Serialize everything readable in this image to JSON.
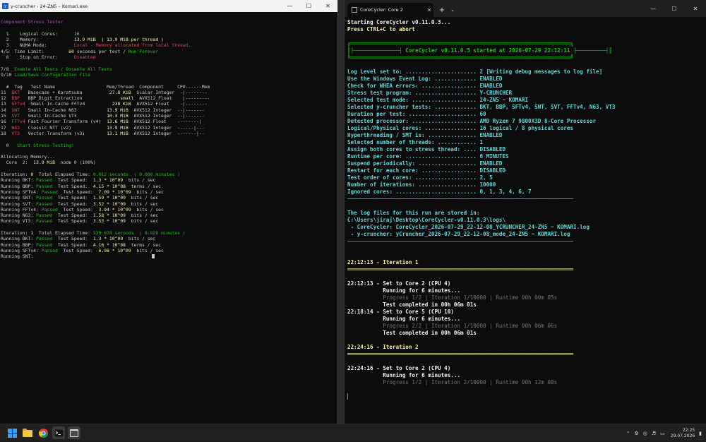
{
  "left_window": {
    "title": "y-cruncher - 24-ZN5 – Komari.exe",
    "lines": [
      [
        [
          "",
          ""
        ]
      ],
      [
        [
          "c-magenta",
          "Component Stress Tester"
        ]
      ],
      [
        [
          "",
          ""
        ]
      ],
      [
        [
          "",
          "  1    Logical Cores:      "
        ],
        [
          "c-cyan",
          "16"
        ]
      ],
      [
        [
          "",
          "  2    Memory:             "
        ],
        [
          "c-yellow",
          "13.9 MiB  ( 13.9 MiB per thread )"
        ]
      ],
      [
        [
          "",
          "  3    NUMA Mode:          "
        ],
        [
          "c-red",
          "Local - Memory allocated from local thread."
        ]
      ],
      [
        [
          "",
          "4/5  Time Limit:         "
        ],
        [
          "c-yellow",
          "60"
        ],
        [
          "",
          " seconds per test / "
        ],
        [
          "c-green",
          "Run Forever"
        ]
      ],
      [
        [
          "",
          "  6    Stop on Error:      "
        ],
        [
          "c-red",
          "Disabled"
        ]
      ],
      [
        [
          "",
          ""
        ]
      ],
      [
        [
          "",
          "7/8  "
        ],
        [
          "c-green",
          "Enable All Tests / Disable All Tests"
        ]
      ],
      [
        [
          "",
          "9/10 "
        ],
        [
          "c-green",
          "Load/Save Configuration File"
        ]
      ],
      [
        [
          "",
          ""
        ]
      ],
      [
        [
          "",
          "  #  Tag   Test Name                   Mem/Thread  Component     CPU------Mem"
        ]
      ],
      [
        [
          "",
          "11  "
        ],
        [
          "c-red",
          "BKT"
        ],
        [
          "",
          "   Basecase + Karatsuba          "
        ],
        [
          "c-yellow",
          "27.8 KiB"
        ],
        [
          "",
          "  Scalar Integer  -|--------"
        ]
      ],
      [
        [
          "",
          "12  "
        ],
        [
          "c-red",
          "BBP"
        ],
        [
          "",
          "   BBP Digit Extraction              "
        ],
        [
          "c-yellow",
          "small"
        ],
        [
          "",
          "  AVX512 Float    |---------"
        ]
      ],
      [
        [
          "",
          "13  "
        ],
        [
          "c-red",
          "SFTv4"
        ],
        [
          "",
          "  Small In-Cache FFTv4          "
        ],
        [
          "c-yellow",
          "238 KiB"
        ],
        [
          "",
          "  AVX512 Float    -|--------"
        ]
      ],
      [
        [
          "",
          "14  "
        ],
        [
          "c-red",
          "SNT"
        ],
        [
          "",
          "   Small In-Cache N63           "
        ],
        [
          "c-yellow",
          "13.9 MiB"
        ],
        [
          "",
          "  AVX512 Integer  --|-------"
        ]
      ],
      [
        [
          "",
          "15  "
        ],
        [
          "c-red",
          "SVT"
        ],
        [
          "",
          "   Small In-Cache VT3           "
        ],
        [
          "c-yellow",
          "10.3 MiB"
        ],
        [
          "",
          "  AVX512 Integer  --|-------"
        ]
      ],
      [
        [
          "",
          "16  "
        ],
        [
          "c-red",
          "FFTv4"
        ],
        [
          "",
          " Fast Fourier Transform (v4)  "
        ],
        [
          "c-yellow",
          "13.6 MiB"
        ],
        [
          "",
          "  AVX512 Float    --------|"
        ]
      ],
      [
        [
          "",
          "17  "
        ],
        [
          "c-red",
          "N63"
        ],
        [
          "",
          "   Classic NTT (v2)             "
        ],
        [
          "c-yellow",
          "13.9 MiB"
        ],
        [
          "",
          "  AVX512 Integer  ------|---"
        ]
      ],
      [
        [
          "",
          "18  "
        ],
        [
          "c-red",
          "VT3"
        ],
        [
          "",
          "   Vector Transform (v3)        "
        ],
        [
          "c-yellow",
          "13.1 MiB"
        ],
        [
          "",
          "  AVX512 Integer  -------|--"
        ]
      ],
      [
        [
          "",
          ""
        ]
      ],
      [
        [
          "",
          "  0   "
        ],
        [
          "c-green",
          "Start Stress-Testing!"
        ]
      ],
      [
        [
          "",
          ""
        ]
      ],
      [
        [
          "",
          "Allocating Memory..."
        ]
      ],
      [
        [
          "",
          "  Core  2:  "
        ],
        [
          "c-yellow",
          "13.9 MiB"
        ],
        [
          "",
          "  node 0 (100%)"
        ]
      ],
      [
        [
          "",
          ""
        ]
      ],
      [
        [
          "",
          "Iteration: "
        ],
        [
          "c-yellow",
          "0"
        ],
        [
          "",
          "  Total Elapsed Time: "
        ],
        [
          "c-green",
          "0.012 seconds  ( 0.000 minutes )"
        ]
      ],
      [
        [
          "",
          "Running BKT: "
        ],
        [
          "c-green",
          "Passed"
        ],
        [
          "",
          "  Test Speed:  "
        ],
        [
          "c-yellow",
          "1.3 * 10^09"
        ],
        [
          "",
          "  bits / sec"
        ]
      ],
      [
        [
          "",
          "Running BBP: "
        ],
        [
          "c-green",
          "Passed"
        ],
        [
          "",
          "  Test Speed:  "
        ],
        [
          "c-yellow",
          "4.15 * 10^08"
        ],
        [
          "",
          "  terms / sec"
        ]
      ],
      [
        [
          "",
          "Running SFTv4: "
        ],
        [
          "c-green",
          "Passed"
        ],
        [
          "",
          "  Test Speed:  "
        ],
        [
          "c-yellow",
          "7.09 * 10^09"
        ],
        [
          "",
          "  bits / sec"
        ]
      ],
      [
        [
          "",
          "Running SNT: "
        ],
        [
          "c-green",
          "Passed"
        ],
        [
          "",
          "  Test Speed:  "
        ],
        [
          "c-yellow",
          "1.59 * 10^09"
        ],
        [
          "",
          "  bits / sec"
        ]
      ],
      [
        [
          "",
          "Running SVT: "
        ],
        [
          "c-green",
          "Passed"
        ],
        [
          "",
          "  Test Speed:  "
        ],
        [
          "c-yellow",
          "3.52 * 10^09"
        ],
        [
          "",
          "  bits / sec"
        ]
      ],
      [
        [
          "",
          "Running FFTv4: "
        ],
        [
          "c-green",
          "Passed"
        ],
        [
          "",
          "  Test Speed:  "
        ],
        [
          "c-yellow",
          "3.94 * 10^09"
        ],
        [
          "",
          "  bits / sec"
        ]
      ],
      [
        [
          "",
          "Running N63: "
        ],
        [
          "c-green",
          "Passed"
        ],
        [
          "",
          "  Test Speed:  "
        ],
        [
          "c-yellow",
          "1.58 * 10^09"
        ],
        [
          "",
          "  bits / sec"
        ]
      ],
      [
        [
          "",
          "Running VT3: "
        ],
        [
          "c-green",
          "Passed"
        ],
        [
          "",
          "  Test Speed:  "
        ],
        [
          "c-yellow",
          "3.53 * 10^09"
        ],
        [
          "",
          "  bits / sec"
        ]
      ],
      [
        [
          "",
          ""
        ]
      ],
      [
        [
          "",
          "Iteration: "
        ],
        [
          "c-yellow",
          "1"
        ],
        [
          "",
          "  Total Elapsed Time: "
        ],
        [
          "c-green",
          "529.678 seconds  ( 8.828 minutes )"
        ]
      ],
      [
        [
          "",
          "Running BKT: "
        ],
        [
          "c-green",
          "Passed"
        ],
        [
          "",
          "  Test Speed:  "
        ],
        [
          "c-yellow",
          "1.3 * 10^09"
        ],
        [
          "",
          "  bits / sec"
        ]
      ],
      [
        [
          "",
          "Running BBP: "
        ],
        [
          "c-green",
          "Passed"
        ],
        [
          "",
          "  Test Speed:  "
        ],
        [
          "c-yellow",
          "4.16 * 10^08"
        ],
        [
          "",
          "  terms / sec"
        ]
      ],
      [
        [
          "",
          "Running SFTv4: "
        ],
        [
          "c-green",
          "Passed"
        ],
        [
          "",
          "  Test Speed:  "
        ],
        [
          "c-yellow",
          "6.98 * 10^09"
        ],
        [
          "",
          "  bits / sec"
        ]
      ],
      [
        [
          "",
          "Running SNT:"
        ]
      ]
    ]
  },
  "right_window": {
    "tab_title": "CoreCycler: Core 2",
    "lines": [
      [
        [
          "c-white",
          "Starting CoreCycler v0.11.0.3..."
        ]
      ],
      [
        [
          "c-ltyellow",
          "Press CTRL+C to abort"
        ]
      ],
      [
        [
          "",
          ""
        ]
      ],
      [
        [
          "banner",
          "╔════════════════════════════════════════════════════════════════════╗"
        ]
      ],
      [
        [
          "banner",
          "║├──────────────┤ CoreCycler v0.11.0.3 started at 2026-07-29 22:12:11 ├─────────┤║"
        ]
      ],
      [
        [
          "banner",
          "╚════════════════════════════════════════════════════════════════════╝"
        ]
      ],
      [
        [
          "",
          ""
        ]
      ],
      [
        [
          "c-cyan",
          "Log Level set to: ...................... 2 [Writing debug messages to log file]"
        ]
      ],
      [
        [
          "c-cyan",
          "Use the Windows Event Log: ............. ENABLED"
        ]
      ],
      [
        [
          "c-cyan",
          "Check for WHEA errors: ................. ENABLED"
        ]
      ],
      [
        [
          "c-cyan",
          "Stress test program: ................... Y-CRUNCHER"
        ]
      ],
      [
        [
          "c-cyan",
          "Selected test mode: .................... 24-ZN5 ~ KOMARI"
        ]
      ],
      [
        [
          "c-cyan",
          "Selected y-cruncher tests: ............. BKT, BBP, SFTv4, SNT, SVT, FFTv4, N63, VT3"
        ]
      ],
      [
        [
          "c-cyan",
          "Duration per test: ..................... 60"
        ]
      ],
      [
        [
          "c-cyan",
          "Detected processor: .................... AMD Ryzen 7 9800X3D 8-Core Processor"
        ]
      ],
      [
        [
          "c-cyan",
          "Logical/Physical cores: ................ 16 logical / 8 physical cores"
        ]
      ],
      [
        [
          "c-cyan",
          "Hyperthreading / SMT is: ............... ENABLED"
        ]
      ],
      [
        [
          "c-cyan",
          "Selected number of threads: ............ 1"
        ]
      ],
      [
        [
          "c-cyan",
          "Assign both cores to stress thread: .... DISABLED"
        ]
      ],
      [
        [
          "c-cyan",
          "Runtime per core: ...................... 6 MINUTES"
        ]
      ],
      [
        [
          "c-cyan",
          "Suspend periodically: .................. ENABLED"
        ]
      ],
      [
        [
          "c-cyan",
          "Restart for each core: ................. DISABLED"
        ]
      ],
      [
        [
          "c-cyan",
          "Test order of cores: ................... 2, 5"
        ]
      ],
      [
        [
          "c-cyan",
          "Number of iterations: .................. 10000"
        ]
      ],
      [
        [
          "c-cyan",
          "Ignored cores: ......................... 0, 1, 3, 4, 6, 7"
        ]
      ],
      [
        [
          "hr",
          "──────────────────────────────────────────────────────────────────────"
        ]
      ],
      [
        [
          "",
          ""
        ]
      ],
      [
        [
          "c-cyan",
          "The log files for this run are stored in:"
        ]
      ],
      [
        [
          "c-cyan",
          "C:\\Users\\jiraj\\Desktop\\CoreCycler-v0.11.0.3\\logs\\"
        ]
      ],
      [
        [
          "c-cyan",
          " - CoreCycler: CoreCycler_2026-07-29_22-12-08_YCRUNCHER_24-ZN5 ~ KOMARI.log"
        ]
      ],
      [
        [
          "c-cyan",
          " - y-cruncher: yCruncher_2026-07-29_22-12-08_mode_24-ZN5 ~ KOMARI.log"
        ]
      ],
      [
        [
          "hr",
          "──────────────────────────────────────────────────────────────────────"
        ]
      ],
      [
        [
          "",
          ""
        ]
      ],
      [
        [
          "",
          ""
        ]
      ],
      [
        [
          "c-ltyellow",
          "22:12:13 - Iteration 1"
        ]
      ],
      [
        [
          "c-ltyellow",
          "══════════════════════════════════════════════════════════════════════"
        ]
      ],
      [
        [
          "",
          ""
        ]
      ],
      [
        [
          "c-white",
          "22:12:13 - Set to Core 2 (CPU 4)"
        ]
      ],
      [
        [
          "c-white",
          "           Running for 6 minutes..."
        ]
      ],
      [
        [
          "c-dim",
          "           Progress 1/2 | Iteration 1/10000 | Runtime 00h 00m 05s"
        ]
      ],
      [
        [
          "c-white",
          "           Test completed in 00h 06m 01s"
        ]
      ],
      [
        [
          "c-white",
          "22:18:14 - Set to Core 5 (CPU 10)"
        ]
      ],
      [
        [
          "c-white",
          "           Running for 6 minutes..."
        ]
      ],
      [
        [
          "c-dim",
          "           Progress 2/2 | Iteration 1/10000 | Runtime 00h 06m 06s"
        ]
      ],
      [
        [
          "c-white",
          "           Test completed in 00h 06m 01s"
        ]
      ],
      [
        [
          "",
          ""
        ]
      ],
      [
        [
          "c-ltyellow",
          "22:24:16 - Iteration 2"
        ]
      ],
      [
        [
          "c-ltyellow",
          "══════════════════════════════════════════════════════════════════════"
        ]
      ],
      [
        [
          "",
          ""
        ]
      ],
      [
        [
          "c-white",
          "22:24:16 - Set to Core 2 (CPU 4)"
        ]
      ],
      [
        [
          "c-white",
          "           Running for 6 minutes..."
        ]
      ],
      [
        [
          "c-dim",
          "           Progress 1/2 | Iteration 2/10000 | Runtime 00h 12m 08s"
        ]
      ],
      [
        [
          "",
          ""
        ]
      ],
      [
        [
          "c-white",
          "▏"
        ]
      ]
    ]
  },
  "taskbar": {
    "time": "22:25",
    "date": "29.07.2026"
  }
}
